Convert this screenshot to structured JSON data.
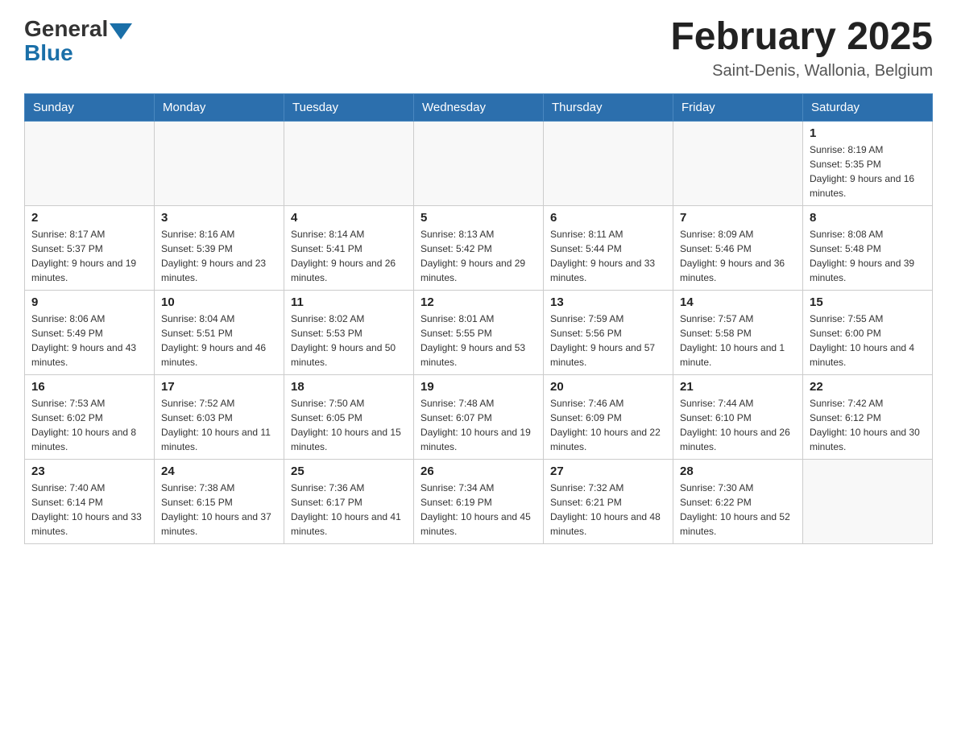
{
  "header": {
    "logo": {
      "general": "General",
      "blue": "Blue"
    },
    "title": "February 2025",
    "location": "Saint-Denis, Wallonia, Belgium"
  },
  "days_of_week": [
    "Sunday",
    "Monday",
    "Tuesday",
    "Wednesday",
    "Thursday",
    "Friday",
    "Saturday"
  ],
  "weeks": [
    {
      "days": [
        {
          "num": "",
          "info": ""
        },
        {
          "num": "",
          "info": ""
        },
        {
          "num": "",
          "info": ""
        },
        {
          "num": "",
          "info": ""
        },
        {
          "num": "",
          "info": ""
        },
        {
          "num": "",
          "info": ""
        },
        {
          "num": "1",
          "info": "Sunrise: 8:19 AM\nSunset: 5:35 PM\nDaylight: 9 hours and 16 minutes."
        }
      ]
    },
    {
      "days": [
        {
          "num": "2",
          "info": "Sunrise: 8:17 AM\nSunset: 5:37 PM\nDaylight: 9 hours and 19 minutes."
        },
        {
          "num": "3",
          "info": "Sunrise: 8:16 AM\nSunset: 5:39 PM\nDaylight: 9 hours and 23 minutes."
        },
        {
          "num": "4",
          "info": "Sunrise: 8:14 AM\nSunset: 5:41 PM\nDaylight: 9 hours and 26 minutes."
        },
        {
          "num": "5",
          "info": "Sunrise: 8:13 AM\nSunset: 5:42 PM\nDaylight: 9 hours and 29 minutes."
        },
        {
          "num": "6",
          "info": "Sunrise: 8:11 AM\nSunset: 5:44 PM\nDaylight: 9 hours and 33 minutes."
        },
        {
          "num": "7",
          "info": "Sunrise: 8:09 AM\nSunset: 5:46 PM\nDaylight: 9 hours and 36 minutes."
        },
        {
          "num": "8",
          "info": "Sunrise: 8:08 AM\nSunset: 5:48 PM\nDaylight: 9 hours and 39 minutes."
        }
      ]
    },
    {
      "days": [
        {
          "num": "9",
          "info": "Sunrise: 8:06 AM\nSunset: 5:49 PM\nDaylight: 9 hours and 43 minutes."
        },
        {
          "num": "10",
          "info": "Sunrise: 8:04 AM\nSunset: 5:51 PM\nDaylight: 9 hours and 46 minutes."
        },
        {
          "num": "11",
          "info": "Sunrise: 8:02 AM\nSunset: 5:53 PM\nDaylight: 9 hours and 50 minutes."
        },
        {
          "num": "12",
          "info": "Sunrise: 8:01 AM\nSunset: 5:55 PM\nDaylight: 9 hours and 53 minutes."
        },
        {
          "num": "13",
          "info": "Sunrise: 7:59 AM\nSunset: 5:56 PM\nDaylight: 9 hours and 57 minutes."
        },
        {
          "num": "14",
          "info": "Sunrise: 7:57 AM\nSunset: 5:58 PM\nDaylight: 10 hours and 1 minute."
        },
        {
          "num": "15",
          "info": "Sunrise: 7:55 AM\nSunset: 6:00 PM\nDaylight: 10 hours and 4 minutes."
        }
      ]
    },
    {
      "days": [
        {
          "num": "16",
          "info": "Sunrise: 7:53 AM\nSunset: 6:02 PM\nDaylight: 10 hours and 8 minutes."
        },
        {
          "num": "17",
          "info": "Sunrise: 7:52 AM\nSunset: 6:03 PM\nDaylight: 10 hours and 11 minutes."
        },
        {
          "num": "18",
          "info": "Sunrise: 7:50 AM\nSunset: 6:05 PM\nDaylight: 10 hours and 15 minutes."
        },
        {
          "num": "19",
          "info": "Sunrise: 7:48 AM\nSunset: 6:07 PM\nDaylight: 10 hours and 19 minutes."
        },
        {
          "num": "20",
          "info": "Sunrise: 7:46 AM\nSunset: 6:09 PM\nDaylight: 10 hours and 22 minutes."
        },
        {
          "num": "21",
          "info": "Sunrise: 7:44 AM\nSunset: 6:10 PM\nDaylight: 10 hours and 26 minutes."
        },
        {
          "num": "22",
          "info": "Sunrise: 7:42 AM\nSunset: 6:12 PM\nDaylight: 10 hours and 30 minutes."
        }
      ]
    },
    {
      "days": [
        {
          "num": "23",
          "info": "Sunrise: 7:40 AM\nSunset: 6:14 PM\nDaylight: 10 hours and 33 minutes."
        },
        {
          "num": "24",
          "info": "Sunrise: 7:38 AM\nSunset: 6:15 PM\nDaylight: 10 hours and 37 minutes."
        },
        {
          "num": "25",
          "info": "Sunrise: 7:36 AM\nSunset: 6:17 PM\nDaylight: 10 hours and 41 minutes."
        },
        {
          "num": "26",
          "info": "Sunrise: 7:34 AM\nSunset: 6:19 PM\nDaylight: 10 hours and 45 minutes."
        },
        {
          "num": "27",
          "info": "Sunrise: 7:32 AM\nSunset: 6:21 PM\nDaylight: 10 hours and 48 minutes."
        },
        {
          "num": "28",
          "info": "Sunrise: 7:30 AM\nSunset: 6:22 PM\nDaylight: 10 hours and 52 minutes."
        },
        {
          "num": "",
          "info": ""
        }
      ]
    }
  ]
}
